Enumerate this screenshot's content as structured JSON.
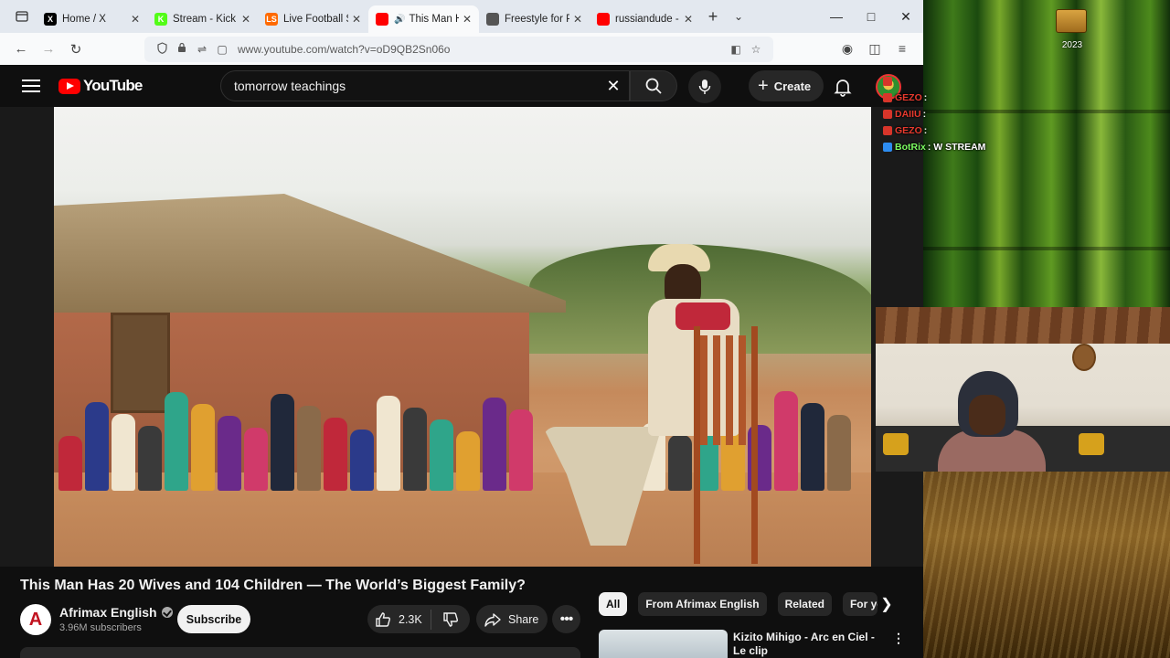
{
  "browser": {
    "tabs": [
      {
        "label": "Home / X",
        "favicon": "X",
        "color": "#000000"
      },
      {
        "label": "Stream - Kick Da",
        "favicon": "K",
        "color": "#53fc18"
      },
      {
        "label": "Live Football Sco",
        "favicon": "LS",
        "color": "#ff6a00"
      },
      {
        "label": "This Man Ha",
        "favicon": "",
        "color": "#ff0000",
        "active": true
      },
      {
        "label": "Freestyle for Par",
        "favicon": "",
        "color": "#555555"
      },
      {
        "label": "russiandude - Yo",
        "favicon": "",
        "color": "#ff0000"
      }
    ],
    "url": "www.youtube.com/watch?v=oD9QB2Sn06o"
  },
  "youtube": {
    "logo_text": "YouTube",
    "search_value": "tomorrow teachings",
    "create_label": "Create"
  },
  "video": {
    "title": "This Man Has 20 Wives and 104 Children — The World’s Biggest Family?",
    "channel": "Afrimax English",
    "channel_initial": "A",
    "subscribers": "3.96M subscribers",
    "subscribe_label": "Subscribe",
    "likes": "2.3K",
    "share_label": "Share"
  },
  "chips": [
    "All",
    "From Afrimax English",
    "Related",
    "For you"
  ],
  "recommended": {
    "title": "Kizito Mihigo - Arc en Ciel - Le clip"
  },
  "stream": {
    "chat": [
      {
        "user": "",
        "text": "",
        "badge": "#d8352a"
      },
      {
        "user": "GEZO",
        "text": ":",
        "badge": "#d8352a"
      },
      {
        "user": "DAIIU",
        "text": ":",
        "badge": "#d8352a"
      },
      {
        "user": "GEZO",
        "text": ":",
        "badge": "#d8352a"
      },
      {
        "user": "BotRix",
        "text": ": W STREAM",
        "badge": "#2d8cf0"
      }
    ],
    "year_label": "2023"
  },
  "colors": {
    "yt_red": "#ff0000",
    "yt_bg": "#0f0f0f",
    "chip_bg": "#272727"
  }
}
